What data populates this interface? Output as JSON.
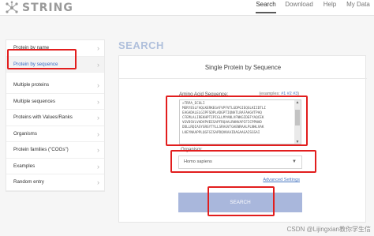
{
  "header": {
    "logo_text": "STRING",
    "nav": [
      "Search",
      "Download",
      "Help",
      "My Data"
    ],
    "active_nav": "Search"
  },
  "sidebar": {
    "items": [
      {
        "label": "Protein by name"
      },
      {
        "label": "Protein by sequence"
      },
      {
        "label": "Multiple proteins"
      },
      {
        "label": "Multiple sequences"
      },
      {
        "label": "Proteins with Values/Ranks"
      },
      {
        "label": "Organisms"
      },
      {
        "label": "Protein families (\"COGs\")"
      },
      {
        "label": "Examples"
      },
      {
        "label": "Random entry"
      }
    ],
    "selected_index": 1
  },
  "main": {
    "section_title": "SEARCH",
    "panel_title": "Single Protein by Sequence",
    "sequence_label": "Amino Acid Sequence:",
    "examples_prefix": "(examples:",
    "examples": [
      "#1",
      "#2",
      "#3"
    ],
    "examples_suffix": ")",
    "sequence_value": ">TRPA_ECOLI\nMERYESLFAQLKERKEGAFVPFVTLGDPGIEQSLKIIDTLI\nEAGADALELGIPFSDPLADGPTIQNATLRAFAAGVTPAQ\nCFEMLALIREKHPTIPIGLLMYANLVFNKGIDEFYAQCEK\nVGVDSVLVADVPVEESAPFRQAALRHNVAPIFICPPNAD\nDDLLRQIASYGRGYTYLLSRAGVTGAENRAALPLNHLVAK\nLKEYNAAPPLQGFGISAPDQVKAAIDAGAAGAISGSAI",
    "organism_label": "Organism:",
    "organism_value": "Homo sapiens",
    "advanced_settings": "Advanced Settings",
    "search_button": "SEARCH"
  },
  "watermark": "CSDN @Lijingxian教你学生信",
  "colors": {
    "highlight": "#e21e1e",
    "button": "#a9b7dc",
    "section_title": "#b0c0dc",
    "link": "#4a78c2"
  }
}
